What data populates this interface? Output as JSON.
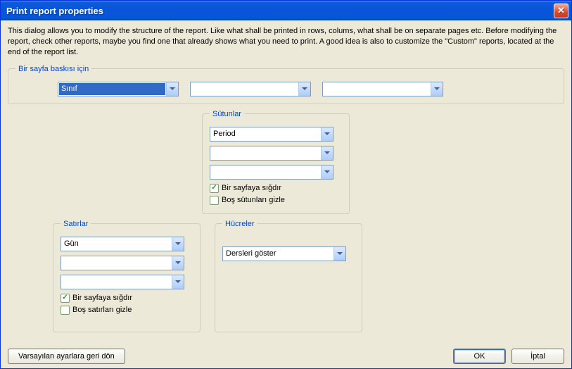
{
  "window": {
    "title": "Print report properties"
  },
  "description": "This dialog allows you to modify the structure of the report. Like what shall be printed in rows, colums, what shall be on separate pages etc. Before modifying the report, check other reports, maybe you find one that already shows what you need to print. A good idea is also to customize the \"Custom\" reports, located at the end of the report list.",
  "group_page": {
    "legend": "Bir sayfa baskısı için",
    "dd1": "Sınıf",
    "dd2": "",
    "dd3": ""
  },
  "group_columns": {
    "legend": "Sütunlar",
    "dd1": "Period",
    "dd2": "",
    "dd3": "",
    "chk_fit": "Bir sayfaya sığdır",
    "chk_fit_checked": true,
    "chk_hide": "Boş sütunları gizle",
    "chk_hide_checked": false
  },
  "group_rows": {
    "legend": "Satırlar",
    "dd1": "Gün",
    "dd2": "",
    "dd3": "",
    "chk_fit": "Bir sayfaya sığdır",
    "chk_fit_checked": true,
    "chk_hide": "Boş satırları gizle",
    "chk_hide_checked": false
  },
  "group_cells": {
    "legend": "Hücreler",
    "dd1": "Dersleri göster"
  },
  "footer": {
    "restore": "Varsayılan ayarlara geri dön",
    "ok": "OK",
    "cancel": "İptal"
  }
}
